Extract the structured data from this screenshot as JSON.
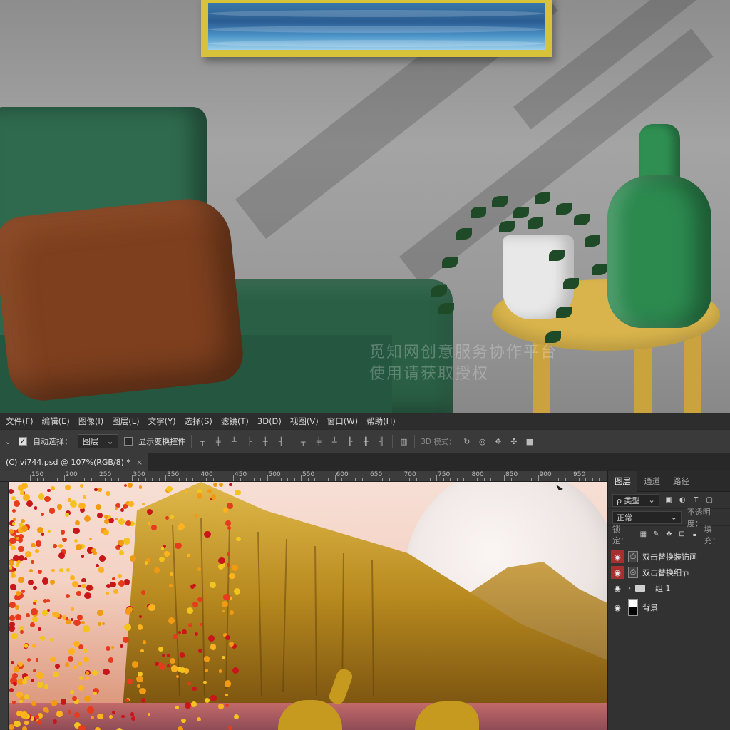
{
  "watermark": {
    "line1": "觅知网创意服务协作平台",
    "line2": "使用请获取授权"
  },
  "menu": [
    "文件(F)",
    "编辑(E)",
    "图像(I)",
    "图层(L)",
    "文字(Y)",
    "选择(S)",
    "滤镜(T)",
    "3D(D)",
    "视图(V)",
    "窗口(W)",
    "帮助(H)"
  ],
  "options": {
    "auto_select_check": "✓",
    "auto_select_label": "自动选择：",
    "auto_select_target": "图层",
    "show_transform_label": "显示变换控件",
    "mode_3d_label": "3D 模式："
  },
  "document_tab": {
    "title": "(C) vi744.psd @ 107%(RGB/8) *",
    "close": "×"
  },
  "ruler_labels": [
    "150",
    "200",
    "250",
    "300",
    "350",
    "400",
    "450",
    "500",
    "550",
    "600",
    "650",
    "700",
    "750",
    "800",
    "850",
    "900",
    "950"
  ],
  "layers_panel": {
    "tabs": [
      "图层",
      "通道",
      "路径"
    ],
    "filter_kind": "ρ 类型",
    "blend_mode": "正常",
    "opacity_label": "不透明度：",
    "lock_label": "锁定：",
    "fill_label": "填充：",
    "layers": [
      {
        "name": "双击替换装饰画",
        "type": "smart",
        "visible_highlight": true
      },
      {
        "name": "双击替换细节",
        "type": "smart",
        "visible_highlight": true
      },
      {
        "name": "组 1",
        "type": "group",
        "visible_highlight": false
      },
      {
        "name": "背景",
        "type": "background",
        "visible_highlight": false
      }
    ]
  },
  "colors": {
    "ps_menu": "#2d2d2d",
    "ps_options": "#3a3a3a",
    "ps_panel": "#323232",
    "eye_highlight": "#a72f2f",
    "frame_gold": "#d8c23a",
    "chair_green": "#2f6a4e"
  }
}
